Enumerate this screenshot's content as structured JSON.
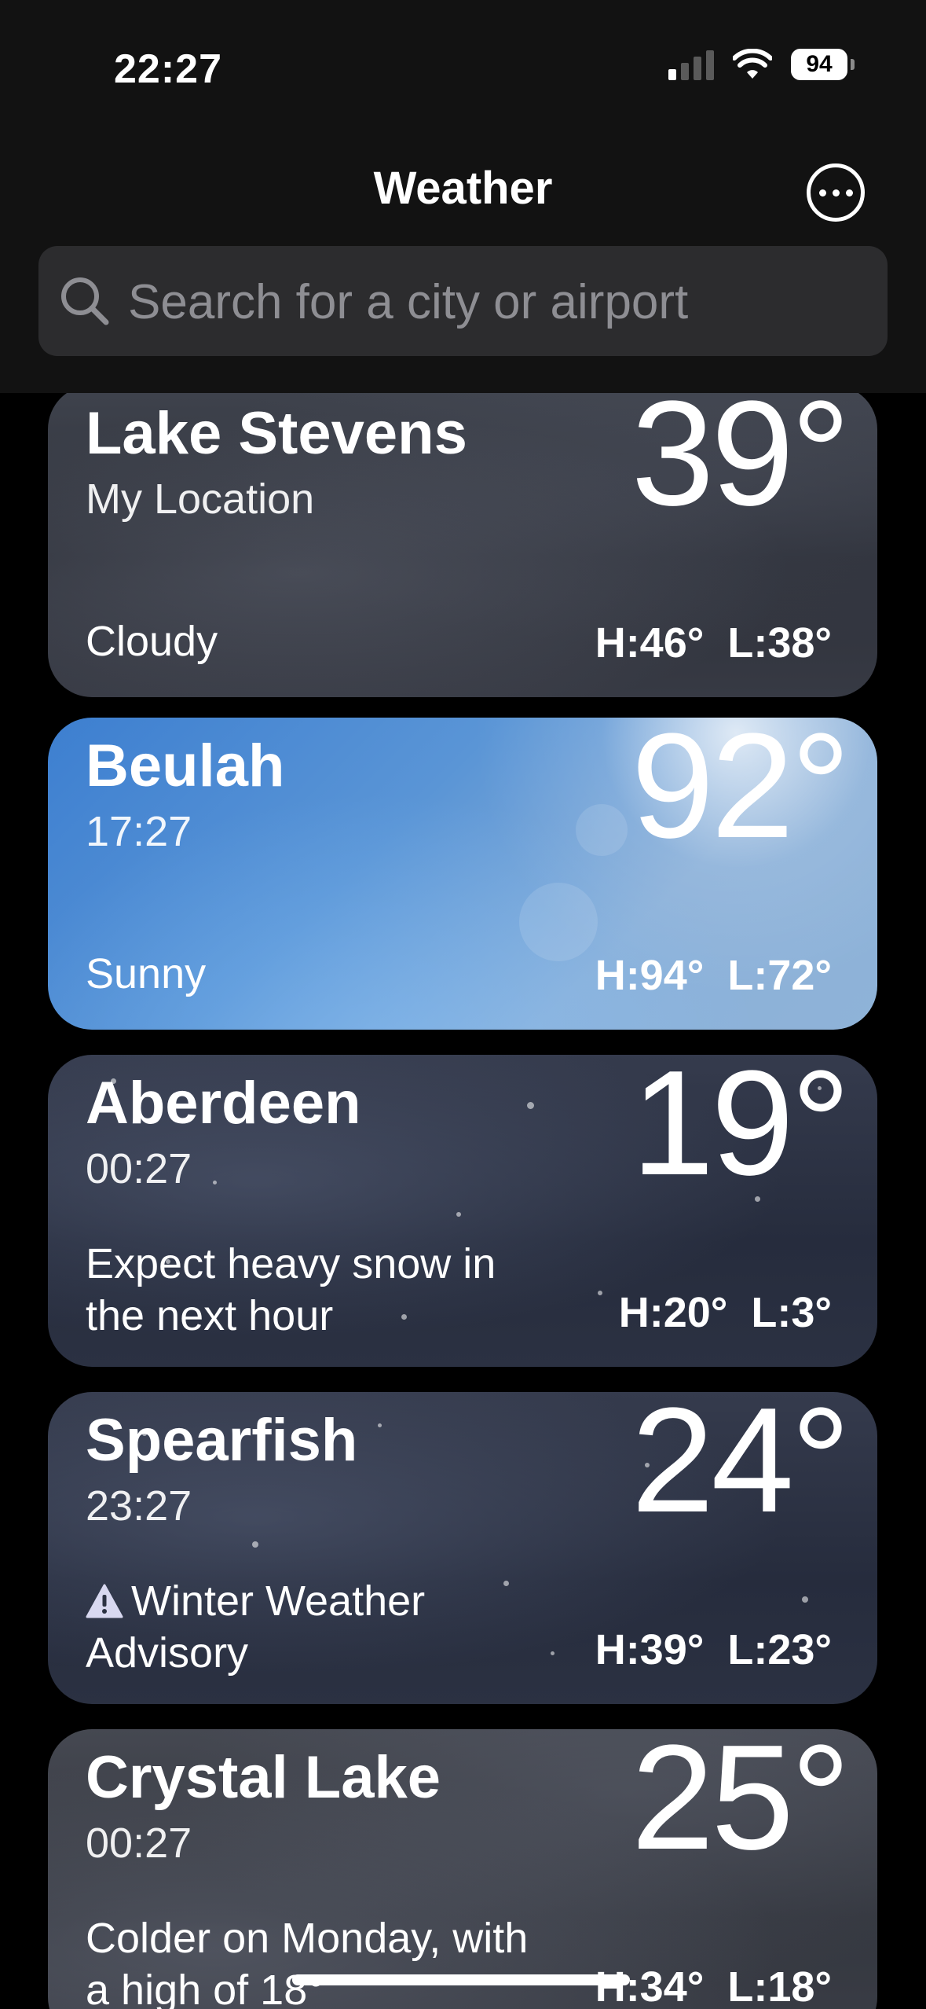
{
  "status_bar": {
    "time": "22:27",
    "battery": "94"
  },
  "header": {
    "title": "Weather"
  },
  "search": {
    "placeholder": "Search for a city or airport"
  },
  "locations": [
    {
      "city": "Lake Stevens",
      "subtitle": "My Location",
      "temp": "39°",
      "condition": "Cloudy",
      "high": "H:46°",
      "low": "L:38°"
    },
    {
      "city": "Beulah",
      "subtitle": "17:27",
      "temp": "92°",
      "condition": "Sunny",
      "high": "H:94°",
      "low": "L:72°"
    },
    {
      "city": "Aberdeen",
      "subtitle": "00:27",
      "temp": "19°",
      "condition": "Expect heavy snow in the next hour",
      "high": "H:20°",
      "low": "L:3°"
    },
    {
      "city": "Spearfish",
      "subtitle": "23:27",
      "temp": "24°",
      "condition": "Winter Weather Advisory",
      "high": "H:39°",
      "low": "L:23°"
    },
    {
      "city": "Crystal Lake",
      "subtitle": "00:27",
      "temp": "25°",
      "condition": "Colder on Monday, with a high of 18°",
      "high": "H:34°",
      "low": "L:18°"
    }
  ],
  "icons": [
    "search-icon",
    "more-icon",
    "warning-icon",
    "wifi-icon",
    "cellular-signal-icon",
    "battery-icon"
  ],
  "colors": {
    "background": "#000000",
    "header": "#121212",
    "search_field": "#2c2c2e",
    "placeholder": "#8e8e93",
    "sunny_card": "#5a95d6"
  }
}
